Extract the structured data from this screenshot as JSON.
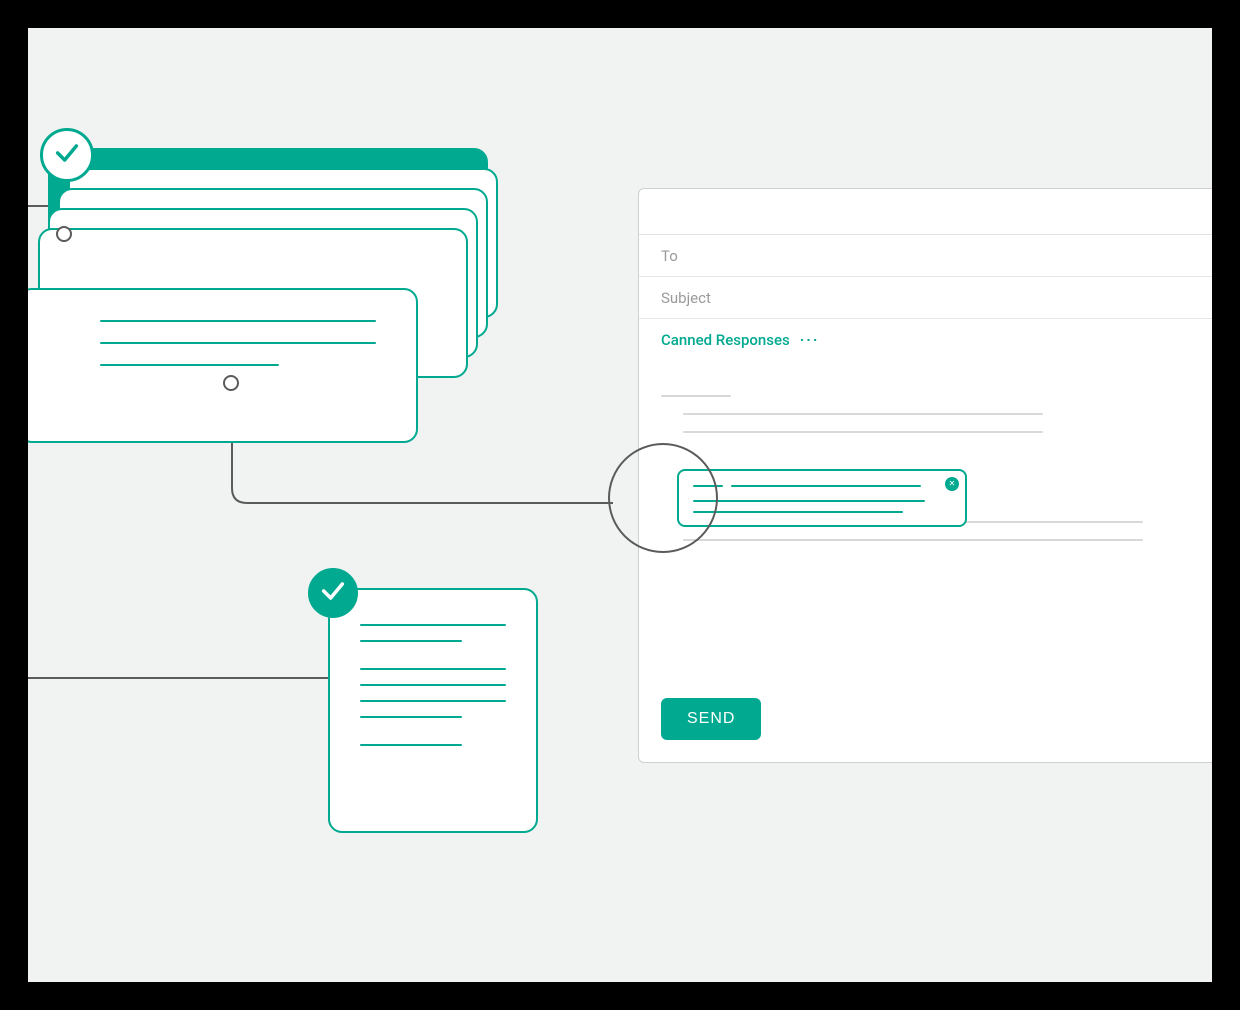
{
  "colors": {
    "accent": "#00a98f",
    "background": "#f1f2f2",
    "frame": "#000000",
    "line_placeholder": "#d9d9d9",
    "text_muted": "#9a9a9a"
  },
  "icons": {
    "check_top": "checkmark-icon",
    "check_doc": "checkmark-icon",
    "chip_close": "close-icon",
    "magnifier": "magnifier-circle"
  },
  "composer": {
    "to_label": "To",
    "subject_label": "Subject",
    "canned_responses_label": "Canned Responses",
    "canned_responses_more": "···",
    "send_label": "SEND"
  }
}
